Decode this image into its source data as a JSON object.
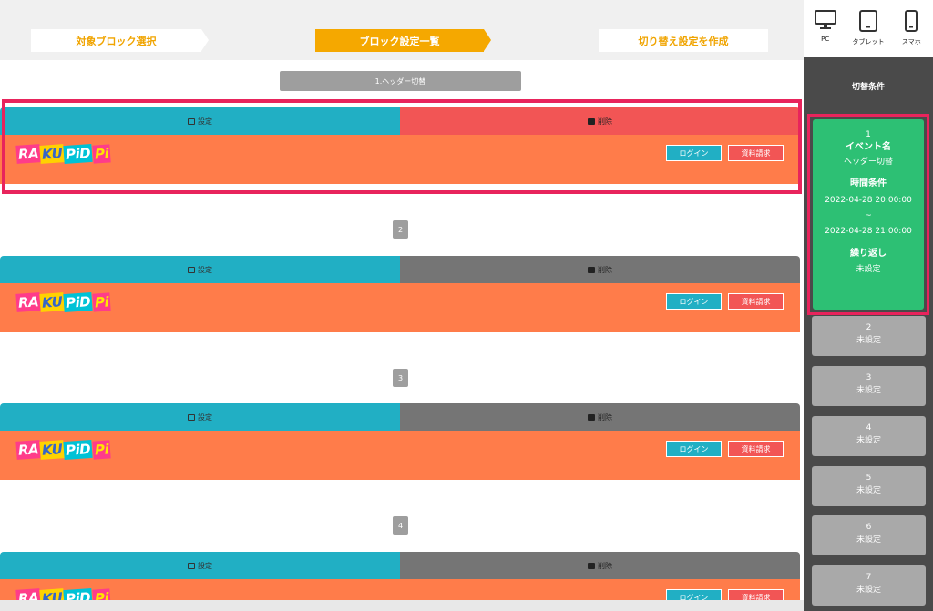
{
  "steps": [
    "対象ブロック選択",
    "ブロック設定一覧",
    "切り替え設定を作成"
  ],
  "event_pill": "1.ヘッダー切替",
  "block_buttons": {
    "settings": "設定",
    "delete": "削除"
  },
  "header_buttons": {
    "login": "ログイン",
    "request_docs": "資料請求"
  },
  "logo": {
    "text": "RAKU PiDPi",
    "parts": [
      "RA",
      "KU",
      "PiD",
      "Pi"
    ]
  },
  "block_numbers": [
    "2",
    "3",
    "4"
  ],
  "sidebar": {
    "devices": [
      {
        "label": "PC",
        "icon": "desktop-icon"
      },
      {
        "label": "タブレット",
        "icon": "tablet-icon"
      },
      {
        "label": "スマホ",
        "icon": "smartphone-icon"
      }
    ],
    "title": "切替条件",
    "active_card": {
      "number": "1",
      "event_label": "イベント名",
      "event_name": "ヘッダー切替",
      "time_label": "時間条件",
      "start": "2022-04-28 20:00:00",
      "tilde": "~",
      "end": "2022-04-28 21:00:00",
      "repeat_label": "繰り返し",
      "repeat_value": "未設定"
    },
    "slots": [
      {
        "number": "2",
        "status": "未設定"
      },
      {
        "number": "3",
        "status": "未設定"
      },
      {
        "number": "4",
        "status": "未設定"
      },
      {
        "number": "5",
        "status": "未設定"
      },
      {
        "number": "6",
        "status": "未設定"
      },
      {
        "number": "7",
        "status": "未設定"
      }
    ]
  },
  "colors": {
    "accent_orange": "#f5a800",
    "teal": "#21afc4",
    "red": "#f25555",
    "green": "#2dc074",
    "highlight": "#e8245c",
    "header_bg": "#ff7c4a"
  }
}
